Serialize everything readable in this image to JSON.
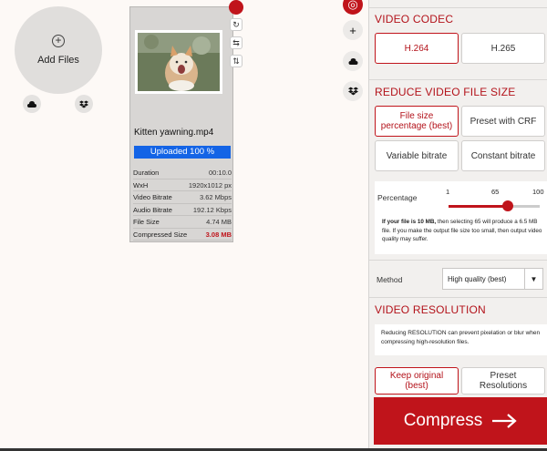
{
  "upload": {
    "add_files_label": "Add Files",
    "sources": [
      "google-drive-icon",
      "dropbox-icon"
    ]
  },
  "file": {
    "name": "Kitten yawning.mp4",
    "progress_text": "Uploaded 100 %",
    "progress": 1.0,
    "meta": [
      {
        "label": "Duration",
        "value": "00:10.0"
      },
      {
        "label": "WxH",
        "value": "1920x1012 px"
      },
      {
        "label": "Video Bitrate",
        "value": "3.62 Mbps"
      },
      {
        "label": "Audio Bitrate",
        "value": "192.12 Kbps"
      },
      {
        "label": "File Size",
        "value": "4.74 MB"
      },
      {
        "label": "Compressed Size",
        "value": "3.08 MB"
      }
    ]
  },
  "codec": {
    "title": "VIDEO CODEC",
    "options": [
      "H.264",
      "H.265"
    ],
    "selected": "H.264"
  },
  "reduce": {
    "title": "REDUCE VIDEO FILE SIZE",
    "options": [
      "File size percentage (best)",
      "Preset with CRF",
      "Variable bitrate",
      "Constant bitrate"
    ],
    "selected": "File size percentage (best)",
    "percentage_label": "Percentage",
    "slider_min": "1",
    "slider_value": "65",
    "slider_max": "100",
    "slider_fraction": 0.65,
    "note_bold": "If your file is 10 MB,",
    "note_rest": " then selecting 65 will produce a 6.5 MB file. If you make the output file size too small, then output video quality may suffer.",
    "method_label": "Method",
    "method_value": "High quality (best)"
  },
  "resolution": {
    "title": "VIDEO RESOLUTION",
    "note": "Reducing RESOLUTION can prevent pixelation or blur when compressing high-resolution files.",
    "options": [
      "Keep original (best)",
      "Preset Resolutions"
    ],
    "selected": "Keep original (best)"
  },
  "compress_label": "Compress",
  "colors": {
    "accent": "#c0141b",
    "progress": "#1464e6"
  }
}
